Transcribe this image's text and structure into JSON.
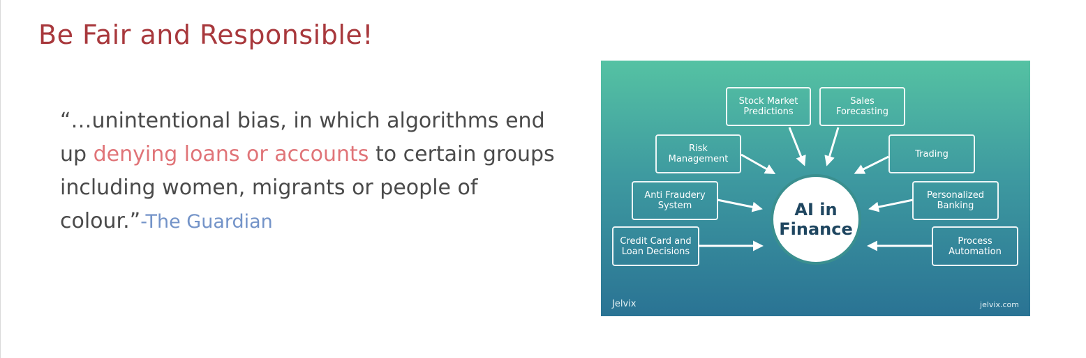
{
  "slide": {
    "title": "Be Fair and Responsible!",
    "quote": {
      "before": "“…unintentional bias, in which algorithms end up ",
      "highlight": "denying loans or accounts",
      "after": " to certain groups including women, migrants or people of colour.”",
      "attribution": "-The Guardian"
    }
  },
  "infographic": {
    "center": "AI in\nFinance",
    "nodes": {
      "stock": "Stock Market\nPredictions",
      "sales": "Sales\nForecasting",
      "risk": "Risk\nManagement",
      "trading": "Trading",
      "fraud": "Anti Fraudery\nSystem",
      "banking": "Personalized\nBanking",
      "credit": "Credit Card and\nLoan Decisions",
      "process": "Process\nAutomation"
    },
    "brand_left": "Jelvix",
    "brand_right": "jelvix.com",
    "colors": {
      "gradient_top": "#55c2a3",
      "gradient_bottom": "#2a7394",
      "accent_title": "#a8383c",
      "highlight": "#e07478",
      "attribution": "#7393c8"
    }
  }
}
